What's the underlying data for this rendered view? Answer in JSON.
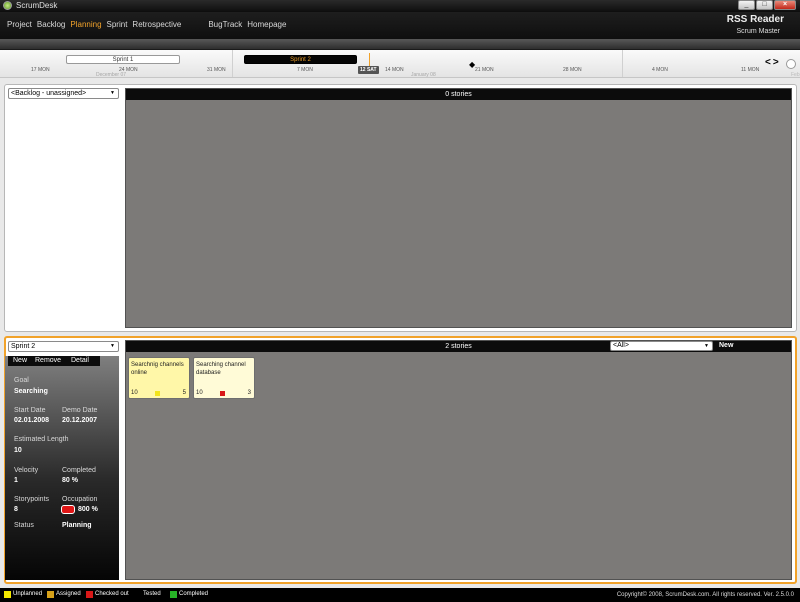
{
  "window": {
    "title": "ScrumDesk",
    "controls": [
      "_",
      "□",
      "×"
    ]
  },
  "menu": {
    "items": [
      "Project",
      "Backlog",
      "Planning",
      "Sprint",
      "Retrospective"
    ],
    "extra": [
      "BugTrack",
      "Homepage"
    ],
    "active": "Planning"
  },
  "header": {
    "project_name": "RSS Reader",
    "user_role": "Scrum Master"
  },
  "timeline": {
    "sprints": [
      "Sprint 1",
      "Sprint 2"
    ],
    "days": [
      "17 MON",
      "24 MON",
      "31 MON",
      "7 MON",
      "14 MON",
      "21 MON",
      "28 MON",
      "4 MON",
      "11 MON"
    ],
    "today": "12 SAT",
    "months": [
      "December 07",
      "January 08",
      "Feb"
    ],
    "nav": "<>"
  },
  "backlog_panel": {
    "selector": "<Backlog - unassigned>",
    "stories_header": "0 stories"
  },
  "sprint_panel": {
    "selector": "Sprint 2",
    "toolbar": {
      "new": "New",
      "remove": "Remove",
      "detail": "Detail"
    },
    "stories_header": "2 stories",
    "filter": "<All>",
    "new_label": "New",
    "details": {
      "goal_label": "Goal",
      "goal": "Searching",
      "start_label": "Start Date",
      "start": "02.01.2008",
      "demo_label": "Demo Date",
      "demo": "20.12.2007",
      "length_label": "Estimated Length",
      "length": "10",
      "velocity_label": "Velocity",
      "velocity": "1",
      "completed_label": "Completed",
      "completed": "80 %",
      "points_label": "Storypoints",
      "points": "8",
      "occupation_label": "Occupation",
      "occupation": "800 %",
      "status_label": "Status",
      "status": "Planning"
    },
    "cards": [
      {
        "title": "Searchnig channels online",
        "left": "10",
        "right": "5",
        "color": "#fff7a8",
        "indicator": "#f2e41a"
      },
      {
        "title": "Searching channel database",
        "left": "10",
        "right": "3",
        "color": "#fffbd7",
        "indicator": "#d81818"
      }
    ]
  },
  "legend": [
    {
      "label": "Unplanned",
      "color": "#f4e800"
    },
    {
      "label": "Assigned",
      "color": "#d7a11a"
    },
    {
      "label": "Checked out",
      "color": "#d81818"
    },
    {
      "label": "Tested",
      "color": "#000000"
    },
    {
      "label": "Completed",
      "color": "#27b327"
    }
  ],
  "copyright": "Copyright© 2008, ScrumDesk.com. All rights reserved. Ver. 2.5.0.0"
}
